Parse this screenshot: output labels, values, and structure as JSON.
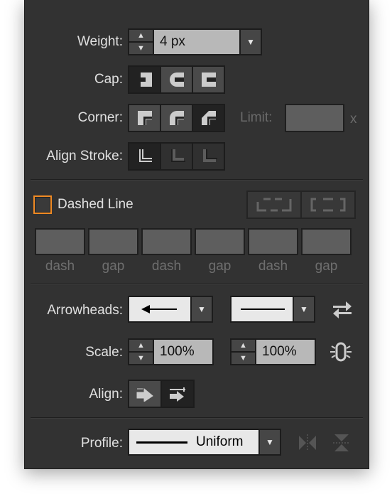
{
  "weight": {
    "label": "Weight:",
    "value": "4 px"
  },
  "cap": {
    "label": "Cap:",
    "selected": "butt-cap"
  },
  "corner": {
    "label": "Corner:",
    "selected": "bevel-join",
    "limit_label": "Limit:",
    "limit_value": "",
    "limit_unit": "x"
  },
  "align_stroke": {
    "label": "Align Stroke:",
    "selected": "center"
  },
  "dashed": {
    "label": "Dashed Line",
    "checked": false,
    "fields": [
      {
        "label": "dash",
        "value": ""
      },
      {
        "label": "gap",
        "value": ""
      },
      {
        "label": "dash",
        "value": ""
      },
      {
        "label": "gap",
        "value": ""
      },
      {
        "label": "dash",
        "value": ""
      },
      {
        "label": "gap",
        "value": ""
      }
    ]
  },
  "arrowheads": {
    "label": "Arrowheads:",
    "start": "arrow-left",
    "end": "none"
  },
  "scale": {
    "label": "Scale:",
    "start": "100%",
    "end": "100%"
  },
  "align": {
    "label": "Align:",
    "selected": "tip-at-end"
  },
  "profile": {
    "label": "Profile:",
    "value": "Uniform"
  },
  "colors": {
    "panel": "#323232",
    "checkbox_focus": "#f08a24",
    "field": "#b8b8b8"
  }
}
